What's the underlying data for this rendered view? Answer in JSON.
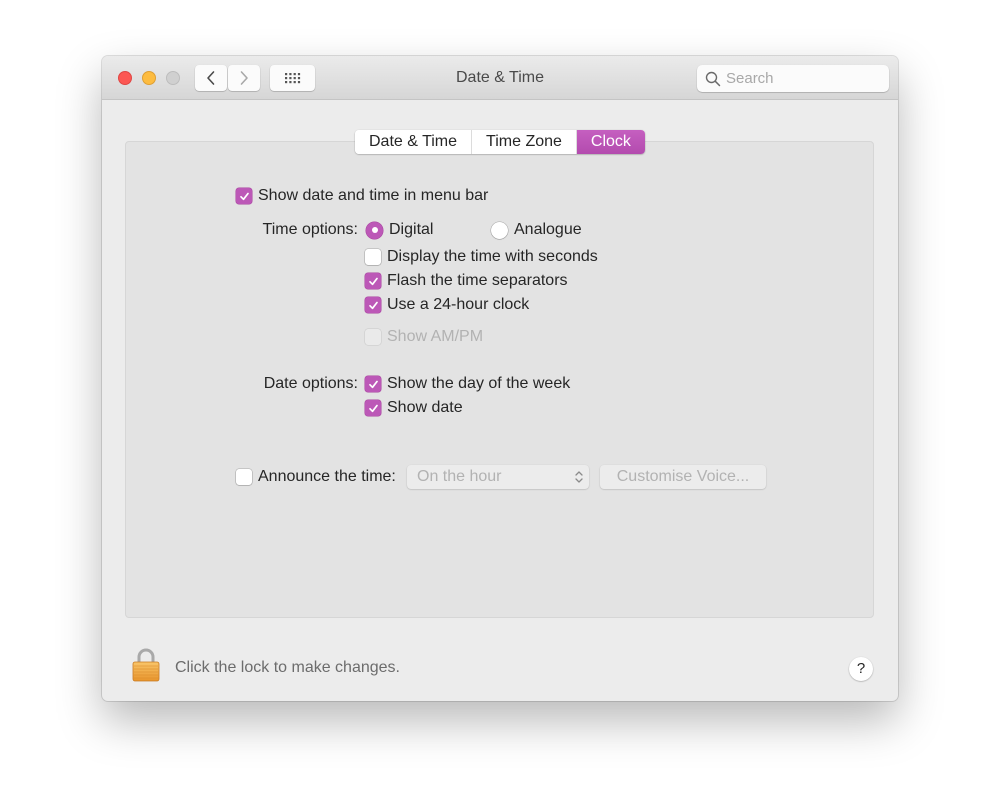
{
  "window": {
    "title": "Date & Time"
  },
  "toolbar": {
    "back_icon": "chevron-left-icon",
    "forward_icon": "chevron-right-icon",
    "grid_icon": "show-all-grid-icon",
    "search": {
      "placeholder": "Search",
      "value": ""
    }
  },
  "tabs": [
    {
      "label": "Date & Time",
      "active": false
    },
    {
      "label": "Time Zone",
      "active": false
    },
    {
      "label": "Clock",
      "active": true
    }
  ],
  "clock": {
    "show_in_menu_bar": {
      "label": "Show date and time in menu bar",
      "checked": true
    },
    "time_options": {
      "label": "Time options:",
      "mode": {
        "options": [
          {
            "label": "Digital",
            "selected": true
          },
          {
            "label": "Analogue",
            "selected": false
          }
        ]
      },
      "display_seconds": {
        "label": "Display the time with seconds",
        "checked": false
      },
      "flash_separators": {
        "label": "Flash the time separators",
        "checked": true
      },
      "use_24_hour": {
        "label": "Use a 24-hour clock",
        "checked": true
      },
      "show_am_pm": {
        "label": "Show AM/PM",
        "checked": false,
        "enabled": false
      }
    },
    "date_options": {
      "label": "Date options:",
      "show_day_of_week": {
        "label": "Show the day of the week",
        "checked": true
      },
      "show_date": {
        "label": "Show date",
        "checked": true
      }
    },
    "announce": {
      "label": "Announce the time:",
      "checked": false,
      "interval": {
        "selected": "On the hour",
        "enabled": false
      },
      "customise_voice_label": "Customise Voice...",
      "customise_voice_enabled": false
    }
  },
  "footer": {
    "lock_icon": "padlock-icon",
    "lock_text": "Click the lock to make changes.",
    "help_label": "?"
  },
  "colors": {
    "accent": "#bc58b7",
    "traffic_close": "#fc5753",
    "traffic_minimize": "#fdbc40",
    "traffic_zoom_disabled": "#d0d0d0"
  }
}
